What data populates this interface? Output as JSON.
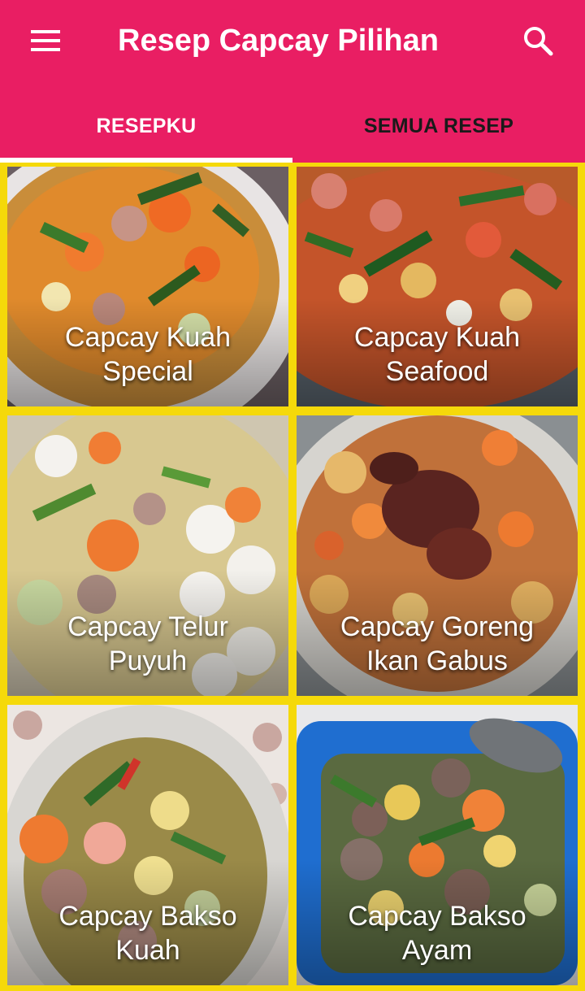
{
  "app_bar": {
    "title": "Resep Capcay Pilihan",
    "menu_icon": "hamburger-menu-icon",
    "search_icon": "search-icon",
    "background_color": "#e91e63"
  },
  "tabs": [
    {
      "label": "RESEPKU",
      "active": true
    },
    {
      "label": "SEMUA RESEP",
      "active": false
    }
  ],
  "grid": {
    "border_color": "#f5d90a",
    "recipes": [
      {
        "title": "Capcay Kuah\nSpecial"
      },
      {
        "title": "Capcay Kuah\nSeafood"
      },
      {
        "title": "Capcay Telur\nPuyuh"
      },
      {
        "title": "Capcay Goreng\nIkan Gabus"
      },
      {
        "title": "Capcay Bakso\nKuah"
      },
      {
        "title": "Capcay Bakso\nAyam"
      }
    ]
  }
}
